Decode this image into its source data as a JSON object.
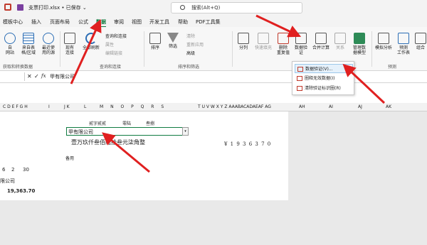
{
  "titlebar": {
    "filename": "支票打印.xlsx • 已保存 ⌄",
    "search_placeholder": "搜索(Alt+Q)"
  },
  "tabs": [
    {
      "label": "模板中心"
    },
    {
      "label": "插入"
    },
    {
      "label": "页面布局"
    },
    {
      "label": "公式"
    },
    {
      "label": "数据",
      "active": true
    },
    {
      "label": "审阅"
    },
    {
      "label": "视图"
    },
    {
      "label": "开发工具"
    },
    {
      "label": "帮助"
    },
    {
      "label": "PDF工具集"
    }
  ],
  "ribbon": {
    "buttons": {
      "from_web": "自\n网站",
      "from_table": "来自表\n格/区域",
      "recent_sources": "最近使\n用的源",
      "existing_conn": "现有\n连接",
      "refresh_all": "全部刷新",
      "sort": "排序",
      "filter": "筛选",
      "split": "分列",
      "flash_fill": "快速填充",
      "remove_dup": "删除\n重复值",
      "data_validation": "数据验\n证",
      "consolidate": "合并计算",
      "relationships": "关系",
      "data_model": "管理数\n据模型",
      "what_if": "模拟分析",
      "forecast_sheet": "预测\n工作表",
      "outline": "组合"
    },
    "small": {
      "queries_connections": "查询和连接",
      "properties": "属性",
      "edit_links": "编辑链接",
      "clear": "清除",
      "reapply": "重新应用",
      "advanced": "高级"
    },
    "groups": {
      "get_transform": "获取和转换数据",
      "queries": "查询和连接",
      "sort_filter": "排序和筛选",
      "forecast": "预测"
    }
  },
  "dropdown": {
    "items": [
      {
        "label": "数据验证(V)..."
      },
      {
        "label": "圈释无效数据(I)"
      },
      {
        "label": "清除验证标识圈(R)"
      }
    ]
  },
  "formula_bar": {
    "name_box": "",
    "fx": "fx",
    "content": "甲有限公司"
  },
  "columns": {
    "left": "C D E F G H",
    "i": "I",
    "jk": "J K",
    "l": "L",
    "mnopqrs": "M N O P Q R S",
    "t_ae": "T U V W X Y Z AAABACADAEAF AG",
    "ah": "AH",
    "ai": "AI",
    "aj": "AJ",
    "ak": "AK"
  },
  "sheet": {
    "headers": {
      "h1": "贰字贰贰",
      "h2": "零陆",
      "h3": "叁捌"
    },
    "cell_value": "甲有限公司",
    "chinese_amount": "壹万玖仟叁佰陆拾叁元柒角整",
    "numeric_amount": "¥ 1 9 3 6 3 7 0",
    "purpose": "备用",
    "date_nums": [
      "6",
      "2",
      "30"
    ],
    "company_short": "限公司",
    "amount": "19,363.70"
  }
}
